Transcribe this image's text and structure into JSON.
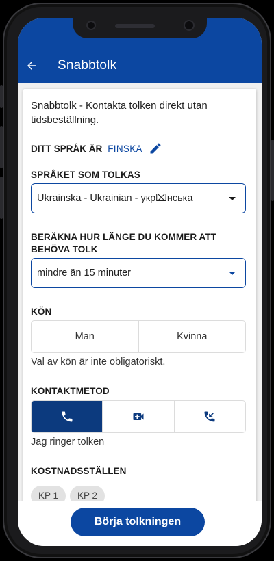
{
  "appbar": {
    "title": "Snabbtolk"
  },
  "intro": "Snabbtolk - Kontakta tolken direkt utan tidsbeställning.",
  "your_language": {
    "label": "DITT SPRÅK ÄR",
    "value": "FINSKA"
  },
  "interpreted_language": {
    "label": "SPRÅKET SOM TOLKAS",
    "selected": "Ukrainska - Ukrainian - укр⌧нська"
  },
  "duration": {
    "label": "BERÄKNA HUR LÄNGE DU KOMMER ATT BEHÖVA TOLK",
    "selected": "mindre än 15 minuter"
  },
  "gender": {
    "label": "KÖN",
    "options": [
      "Man",
      "Kvinna"
    ],
    "note": "Val av kön är inte obligatoriskt."
  },
  "contact": {
    "label": "KONTAKTMETOD",
    "selected_index": 0,
    "note": "Jag ringer tolken",
    "icons": [
      "phone-icon",
      "video-call-icon",
      "incoming-call-icon"
    ]
  },
  "cost_centers": {
    "label": "KOSTNADSSTÄLLEN",
    "chips": [
      "KP 1",
      "KP 2"
    ]
  },
  "start_button": "Börja tolkningen",
  "colors": {
    "primary": "#0c47a1",
    "active_segment": "#0c3a7e"
  }
}
